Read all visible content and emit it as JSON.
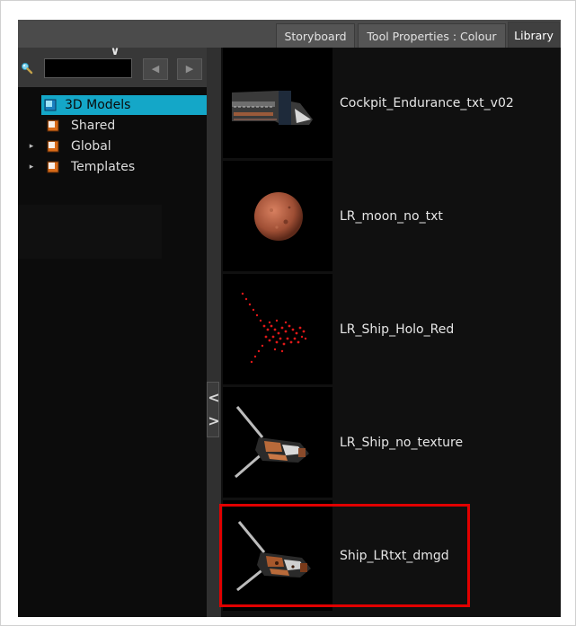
{
  "tabs": [
    {
      "label": "Storyboard"
    },
    {
      "label": "Tool Properties : Colour"
    },
    {
      "label": "Library"
    }
  ],
  "sidebar": {
    "collapse_glyph": "∨",
    "search": {
      "value": "",
      "placeholder": "",
      "icon": "search-icon"
    },
    "nav": {
      "back_glyph": "◀",
      "forward_glyph": "▶"
    },
    "tree": [
      {
        "label": "3D Models",
        "selected": true,
        "expandable": false
      },
      {
        "label": "Shared",
        "selected": false,
        "expandable": false
      },
      {
        "label": "Global",
        "selected": false,
        "expandable": true
      },
      {
        "label": "Templates",
        "selected": false,
        "expandable": true
      }
    ],
    "expand_glyph": "▸"
  },
  "splitter": {
    "collapse_glyph": "<",
    "expand_glyph": ">"
  },
  "library": {
    "items": [
      {
        "name": "Cockpit_Endurance_txt_v02",
        "thumbnail": "cockpit-thumbnail"
      },
      {
        "name": "LR_moon_no_txt",
        "thumbnail": "moon-thumbnail"
      },
      {
        "name": "LR_Ship_Holo_Red",
        "thumbnail": "holo-ship-thumbnail"
      },
      {
        "name": "LR_Ship_no_texture",
        "thumbnail": "ship-thumbnail"
      },
      {
        "name": "Ship_LRtxt_dmgd",
        "thumbnail": "damaged-ship-thumbnail",
        "highlighted": true
      }
    ]
  },
  "colors": {
    "selection": "#14a7c8",
    "highlight_box": "#e10000",
    "panel_bg": "#101010"
  }
}
